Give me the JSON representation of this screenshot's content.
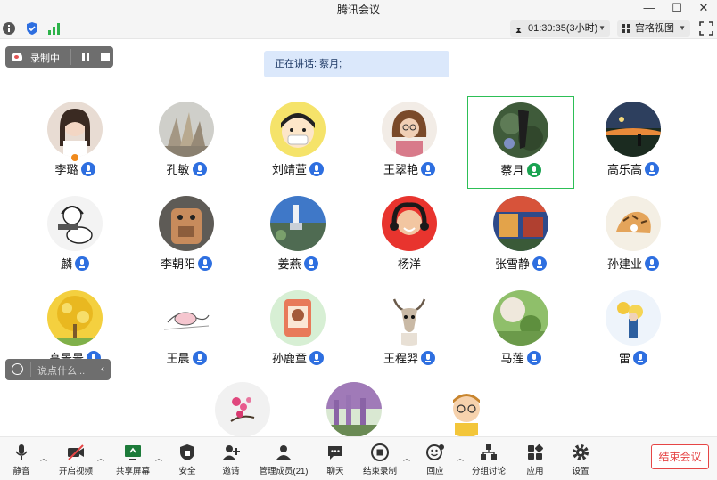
{
  "window": {
    "title": "腾讯会议"
  },
  "topbar": {
    "timer": "01:30:35(3小时)",
    "view_mode": "宫格视图",
    "icons": [
      "info-icon",
      "shield-icon",
      "signal-icon",
      "hourglass-icon",
      "grid-icon",
      "fullscreen-icon"
    ]
  },
  "recording": {
    "label": "录制中"
  },
  "speaking": {
    "text": "正在讲话: 蔡月;"
  },
  "participants": [
    {
      "name": "李璐",
      "mic": "on",
      "host": true
    },
    {
      "name": "孔敏",
      "mic": "on"
    },
    {
      "name": "刘靖萱",
      "mic": "on"
    },
    {
      "name": "王翠艳",
      "mic": "on"
    },
    {
      "name": "蔡月",
      "mic": "speaking",
      "active": true
    },
    {
      "name": "高乐高",
      "mic": "on"
    },
    {
      "name": "麟",
      "mic": "on"
    },
    {
      "name": "李朝阳",
      "mic": "on"
    },
    {
      "name": "姜燕",
      "mic": "on"
    },
    {
      "name": "杨洋",
      "mic": "none"
    },
    {
      "name": "张雪静",
      "mic": "on"
    },
    {
      "name": "孙建业",
      "mic": "on"
    },
    {
      "name": "高景景",
      "mic": "on"
    },
    {
      "name": "王晨",
      "mic": "on"
    },
    {
      "name": "孙鹿童",
      "mic": "on"
    },
    {
      "name": "王程羿",
      "mic": "on"
    },
    {
      "name": "马莲",
      "mic": "on"
    },
    {
      "name": "雷",
      "mic": "on"
    }
  ],
  "chat": {
    "placeholder": "说点什么..."
  },
  "toolbar": {
    "mute": "静音",
    "video": "开启视频",
    "share": "共享屏幕",
    "security": "安全",
    "invite": "邀请",
    "members": "管理成员(21)",
    "chat": "聊天",
    "stop_record": "结束录制",
    "reaction": "回应",
    "breakout": "分组讨论",
    "apps": "应用",
    "settings": "设置",
    "end_meeting": "结束会议"
  },
  "colors": {
    "accent": "#2e6fe0",
    "speaking": "#1aa351",
    "danger": "#e64545",
    "active_border": "#2dbf56"
  }
}
